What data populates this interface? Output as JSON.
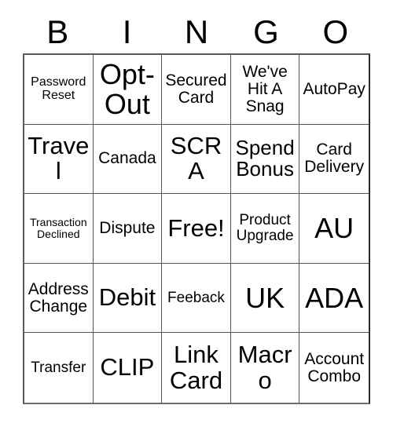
{
  "card": {
    "title": "BINGO",
    "header_letters": [
      "B",
      "I",
      "N",
      "G",
      "O"
    ],
    "grid_size": "5x5",
    "colors": {
      "background": "#ffffff",
      "text": "#000000",
      "inner_border": "#555555",
      "outer_border": "#2b2b2b"
    },
    "cells": [
      {
        "text": "Password Reset",
        "size": "sz-s",
        "row": 1,
        "col": 1
      },
      {
        "text": "Opt-Out",
        "size": "sz-xxl",
        "row": 1,
        "col": 2
      },
      {
        "text": "Secured Card",
        "size": "sz-ml",
        "row": 1,
        "col": 3
      },
      {
        "text": "We've Hit A Snag",
        "size": "sz-ml",
        "row": 1,
        "col": 4
      },
      {
        "text": "AutoPay",
        "size": "sz-ml",
        "row": 1,
        "col": 5
      },
      {
        "text": "Travel",
        "size": "sz-xl",
        "row": 2,
        "col": 1
      },
      {
        "text": "Canada",
        "size": "sz-ml",
        "row": 2,
        "col": 2
      },
      {
        "text": "SCRA",
        "size": "sz-xl",
        "row": 2,
        "col": 3
      },
      {
        "text": "Spend Bonus",
        "size": "sz-l",
        "row": 2,
        "col": 4
      },
      {
        "text": "Card Delivery",
        "size": "sz-ml",
        "row": 2,
        "col": 5
      },
      {
        "text": "Transaction Declined",
        "size": "sz-xs",
        "row": 3,
        "col": 1
      },
      {
        "text": "Dispute",
        "size": "sz-ml",
        "row": 3,
        "col": 2
      },
      {
        "text": "Free!",
        "size": "sz-xl",
        "row": 3,
        "col": 3
      },
      {
        "text": "Product Upgrade",
        "size": "sz-m",
        "row": 3,
        "col": 4
      },
      {
        "text": "AU",
        "size": "sz-xxl",
        "row": 3,
        "col": 5
      },
      {
        "text": "Address Change",
        "size": "sz-ml",
        "row": 4,
        "col": 1
      },
      {
        "text": "Debit",
        "size": "sz-xl",
        "row": 4,
        "col": 2
      },
      {
        "text": "Feeback",
        "size": "sz-m",
        "row": 4,
        "col": 3
      },
      {
        "text": "UK",
        "size": "sz-xxl",
        "row": 4,
        "col": 4
      },
      {
        "text": "ADA",
        "size": "sz-xxl",
        "row": 4,
        "col": 5
      },
      {
        "text": "Transfer",
        "size": "sz-m",
        "row": 5,
        "col": 1
      },
      {
        "text": "CLIP",
        "size": "sz-xl",
        "row": 5,
        "col": 2
      },
      {
        "text": "Link Card",
        "size": "sz-xl",
        "row": 5,
        "col": 3
      },
      {
        "text": "Macro",
        "size": "sz-xl",
        "row": 5,
        "col": 4
      },
      {
        "text": "Account Combo",
        "size": "sz-ml",
        "row": 5,
        "col": 5
      }
    ]
  }
}
